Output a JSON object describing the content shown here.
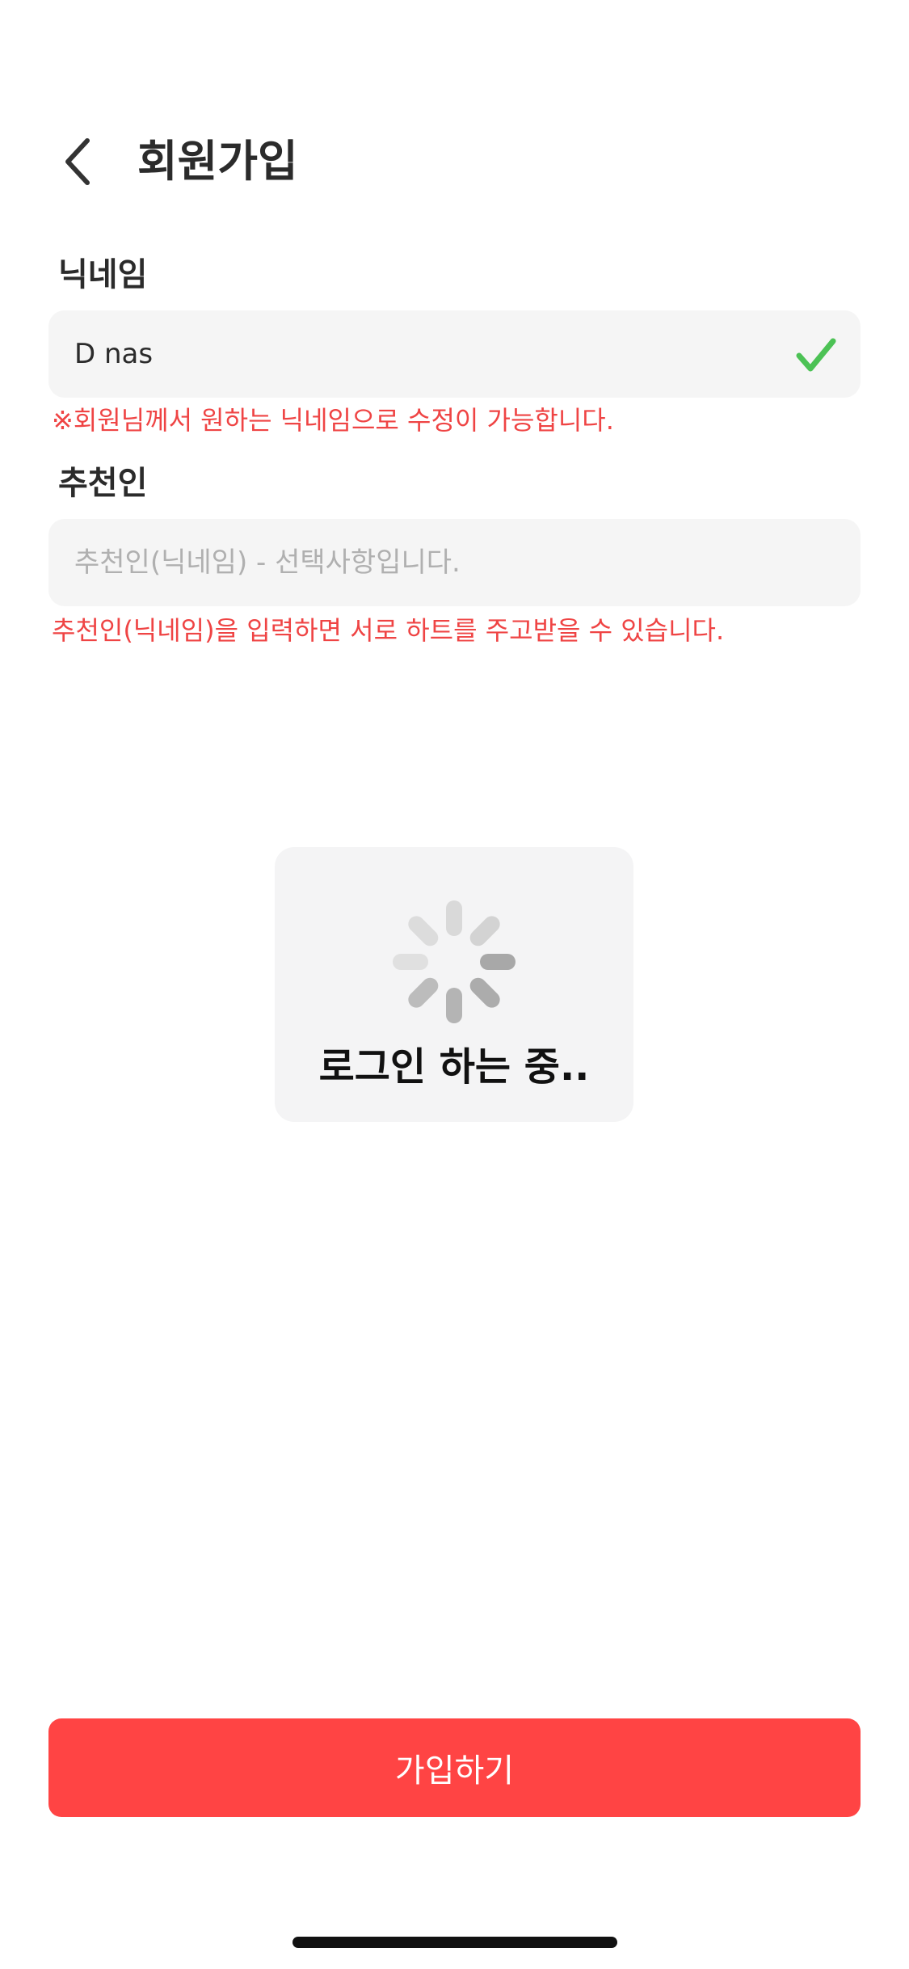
{
  "header": {
    "title": "회원가입",
    "back_icon": "chevron-left-icon"
  },
  "nickname": {
    "label": "닉네임",
    "value": "D nas",
    "status_icon": "check-icon",
    "hint": "※회원님께서 원하는 닉네임으로 수정이 가능합니다."
  },
  "referrer": {
    "label": "추천인",
    "value": "",
    "placeholder": "추천인(닉네임) - 선택사항입니다.",
    "hint": "추천인(닉네임)을 입력하면 서로 하트를 주고받을 수 있습니다."
  },
  "loading": {
    "icon": "spinner-icon",
    "text": "로그인 하는 중.."
  },
  "footer": {
    "submit_label": "가입하기"
  },
  "colors": {
    "accent": "#ff4444",
    "hint": "#ef4444",
    "valid": "#4cc255",
    "field_bg": "#f5f5f5"
  }
}
